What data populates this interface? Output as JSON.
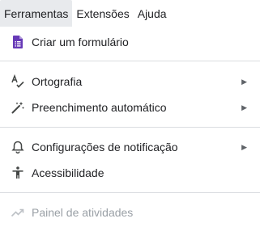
{
  "menubar": {
    "items": [
      {
        "label": "Ferramentas"
      },
      {
        "label": "Extensões"
      },
      {
        "label": "Ajuda"
      }
    ]
  },
  "menu": {
    "create_form": {
      "label": "Criar um formulário",
      "icon": "forms-icon",
      "icon_color": "#673ab7"
    },
    "spelling": {
      "label": "Ortografia",
      "icon": "spellcheck-icon"
    },
    "autofill": {
      "label": "Preenchimento automático",
      "icon": "magic-wand-icon"
    },
    "notifications": {
      "label": "Configurações de notificação",
      "icon": "bell-icon"
    },
    "accessibility": {
      "label": "Acessibilidade",
      "icon": "accessibility-icon"
    },
    "activity_dashboard": {
      "label": "Painel de atividades",
      "icon": "trending-up-icon",
      "disabled": true
    }
  }
}
